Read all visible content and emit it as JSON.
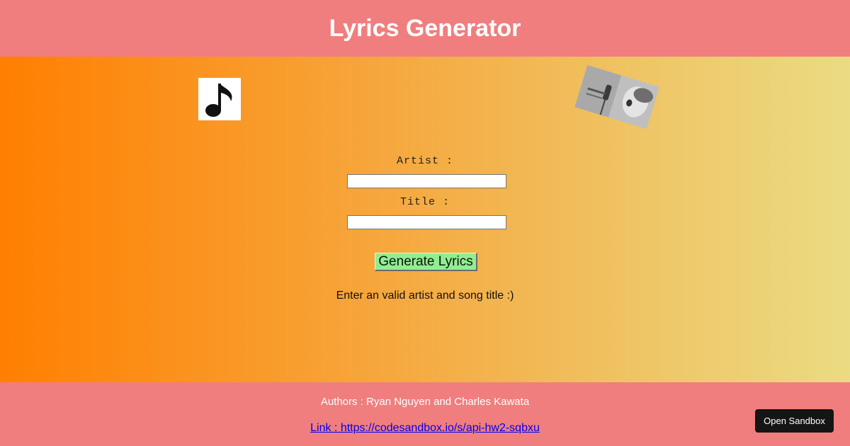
{
  "header": {
    "title": "Lyrics Generator"
  },
  "images": {
    "note_icon": "music-note-icon",
    "singer_photo": "singer-photo"
  },
  "form": {
    "artist_label": "Artist :",
    "artist_value": "",
    "title_label": "Title :",
    "title_value": "",
    "button_label": "Generate Lyrics",
    "status_text": "Enter an valid artist and song title :)"
  },
  "footer": {
    "authors": "Authors : Ryan Nguyen and Charles Kawata",
    "link_text": "Link : https://codesandbox.io/s/api-hw2-sqbxu",
    "sandbox_button": "Open Sandbox"
  },
  "colors": {
    "header_bg": "#f07e7e",
    "footer_bg": "#f07e7e",
    "gradient_start": "#ff7f00",
    "gradient_end": "#ebdb82",
    "button_bg": "#90ee90",
    "sandbox_bg": "#151515"
  }
}
